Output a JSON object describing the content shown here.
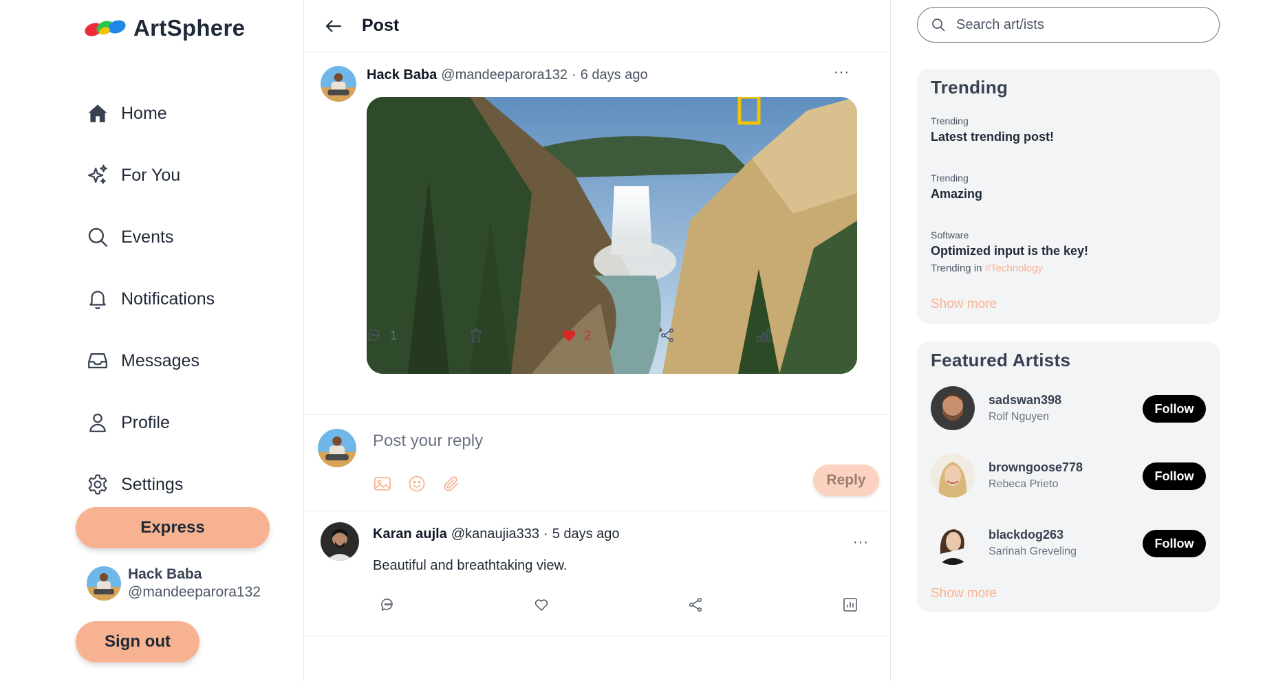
{
  "app": {
    "name": "ArtSphere"
  },
  "nav": {
    "home": "Home",
    "for_you": "For You",
    "events": "Events",
    "notifications": "Notifications",
    "messages": "Messages",
    "profile": "Profile",
    "settings": "Settings"
  },
  "sidebar": {
    "express_label": "Express",
    "user_name": "Hack Baba",
    "user_handle": "@mandeeparora132",
    "signout_label": "Sign out"
  },
  "header": {
    "title": "Post"
  },
  "post": {
    "author_name": "Hack Baba",
    "author_handle": "@mandeeparora132",
    "separator": "·",
    "time": "6 days ago",
    "more": "···",
    "comment_count": "1",
    "like_count": "2",
    "liked": true
  },
  "reply": {
    "placeholder": "Post your reply",
    "button_label": "Reply"
  },
  "comment": {
    "author_name": "Karan aujla",
    "author_handle": "@kanaujia333",
    "separator": "·",
    "time": "5 days ago",
    "text": "Beautiful and breathtaking view.",
    "more": "···"
  },
  "search": {
    "placeholder": "Search art/ists"
  },
  "trending": {
    "title": "Trending",
    "items": [
      {
        "category": "Trending",
        "title": "Latest trending post!"
      },
      {
        "category": "Trending",
        "title": "Amazing"
      },
      {
        "category": "Software",
        "title": "Optimized input is the key!",
        "subtitle_prefix": "Trending in",
        "tag": "#Technology"
      }
    ],
    "show_more": "Show more"
  },
  "featured": {
    "title": "Featured Artists",
    "artists": [
      {
        "username": "sadswan398",
        "name": "Rolf Nguyen",
        "follow": "Follow"
      },
      {
        "username": "browngoose778",
        "name": "Rebeca Prieto",
        "follow": "Follow"
      },
      {
        "username": "blackdog263",
        "name": "Sarinah Greveling",
        "follow": "Follow"
      }
    ],
    "show_more": "Show more"
  },
  "colors": {
    "accent": "#f7b391",
    "like": "#dc2626",
    "text": "#1f2937",
    "card_bg": "#f3f4f6"
  },
  "icons": {
    "nav": [
      "home-icon",
      "sparkles-icon",
      "search-icon",
      "bell-icon",
      "inbox-icon",
      "user-icon",
      "gear-icon"
    ],
    "post_actions": [
      "comment-icon",
      "trash-icon",
      "heart-icon",
      "share-icon",
      "stats-icon"
    ],
    "reply_tools": [
      "image-icon",
      "emoji-icon",
      "paperclip-icon"
    ]
  }
}
